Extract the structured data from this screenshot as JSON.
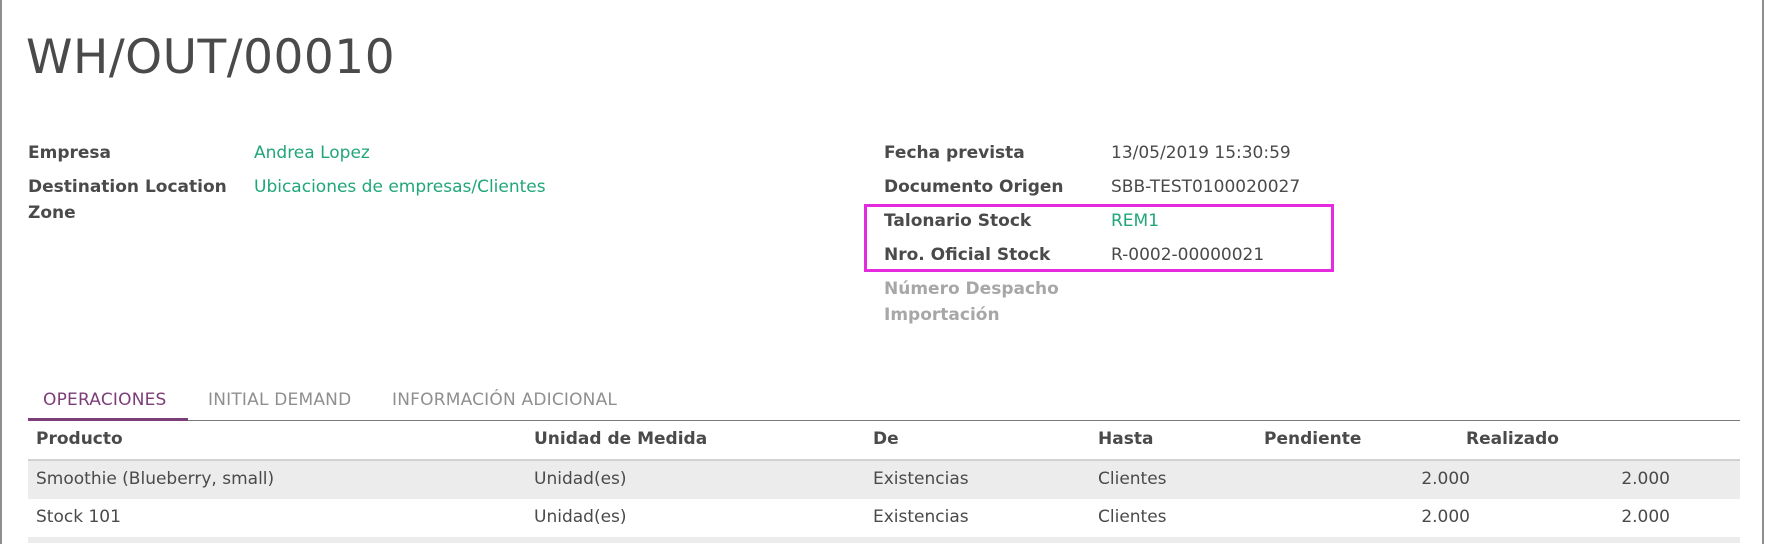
{
  "record": {
    "title": "WH/OUT/00010"
  },
  "left_fields": {
    "empresa_label": "Empresa",
    "empresa_value": "Andrea Lopez",
    "dest_label_line1": "Destination Location",
    "dest_label_line2": "Zone",
    "dest_value": "Ubicaciones de empresas/Clientes"
  },
  "right_fields": {
    "fecha_label": "Fecha prevista",
    "fecha_value": "13/05/2019 15:30:59",
    "origen_label": "Documento Origen",
    "origen_value": "SBB-TEST0100020027",
    "talonario_label": "Talonario Stock",
    "talonario_value": "REM1",
    "nro_label": "Nro. Oficial Stock",
    "nro_value": "R-0002-00000021",
    "despacho_label_line1": "Número Despacho",
    "despacho_label_line2": "Importación"
  },
  "tabs": [
    {
      "label": "OPERACIONES",
      "active": true
    },
    {
      "label": "INITIAL DEMAND",
      "active": false
    },
    {
      "label": "INFORMACIÓN ADICIONAL",
      "active": false
    }
  ],
  "table": {
    "headers": [
      "Producto",
      "Unidad de Medida",
      "De",
      "Hasta",
      "Pendiente",
      "Realizado"
    ],
    "rows": [
      {
        "producto": "Smoothie (Blueberry, small)",
        "unidad": "Unidad(es)",
        "de": "Existencias",
        "hasta": "Clientes",
        "pendiente": "2.000",
        "realizado": "2.000"
      },
      {
        "producto": "Stock 101",
        "unidad": "Unidad(es)",
        "de": "Existencias",
        "hasta": "Clientes",
        "pendiente": "2.000",
        "realizado": "2.000"
      }
    ]
  },
  "colors": {
    "link": "#21a67a",
    "highlight": "#e52ae0",
    "active_tab": "#7b3e78"
  }
}
